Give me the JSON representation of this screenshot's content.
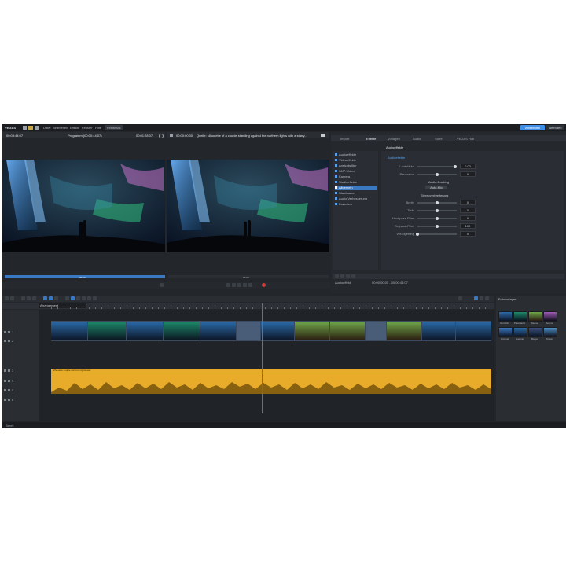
{
  "menubar": {
    "logo": "VEGAS",
    "items": [
      "Datei",
      "Bearbeiten",
      "Effekte",
      "Fenster",
      "Hilfe",
      "Feedback"
    ],
    "ok_label": "Anwenden",
    "cancel_label": "Beenden"
  },
  "source_monitor": {
    "timecode_left": "00:03:44:07",
    "title": "Programm (00:00:44:07)",
    "timecode_right": "00:01:28:07"
  },
  "program_monitor": {
    "timecode": "00:00:00:00",
    "title": "Quelle: silhouette of a couple standing against the northern lights with a starry..."
  },
  "monitor_scrub": {
    "left_progress": 1.0,
    "right_progress": 0.0,
    "left_label": "00:00",
    "right_label": "00:00"
  },
  "effects_panel": {
    "tabs": [
      "Import",
      "Effekte",
      "Vorlagen",
      "Audio",
      "Store",
      "VEGAS Hub"
    ],
    "active_tab": "Effekte",
    "header": "Audioeffekte",
    "categories": [
      "Audioeffekte",
      "Videoeffekte",
      "Ansichtsfilter",
      "360°-Video",
      "Kamera",
      "Studioeffekte",
      "Allgemein",
      "Stabilisator",
      "Audio Verbesserung",
      "Favoriten"
    ],
    "active_category_index": 6,
    "group_title": "Audioeffekte",
    "params": [
      {
        "label": "Lautstärke",
        "value": "0.00",
        "level": 0.95
      },
      {
        "label": "Panorama",
        "value": "0",
        "level": 0.5
      }
    ],
    "section_one": "Audio-Ducking",
    "section_one_button": "Auto-Mix",
    "section_two": "Stereoverbreiterung",
    "params2": [
      {
        "label": "Breite",
        "value": "0",
        "level": 0.5
      },
      {
        "label": "Tiefe",
        "value": "0",
        "level": 0.5
      },
      {
        "label": "Hochpass-Filter",
        "value": "0",
        "level": 0.5
      },
      {
        "label": "Tiefpass-Filter",
        "value": "100",
        "level": 0.5
      },
      {
        "label": "Verzögerung",
        "value": "0",
        "level": 0.0
      }
    ],
    "footer_field": "Audioeffekt",
    "footer_value": "00:00:00:00 - 00:00:44:07"
  },
  "timeline": {
    "title": "Arrangement",
    "tracks": [
      {
        "label": "1"
      },
      {
        "label": "2"
      },
      {
        "label": "3"
      },
      {
        "label": "4"
      },
      {
        "label": "5"
      },
      {
        "label": "6"
      }
    ],
    "audio_label": "silhouette couple northern lights.wav"
  },
  "templates_panel": {
    "title": "Fotovorlagen",
    "captions": [
      "Nordlicht",
      "Polarnacht",
      "Sterne",
      "Aurora",
      "Himmel",
      "Galaxie",
      "Berge",
      "Wolken"
    ]
  },
  "status": {
    "text": "Bereit"
  }
}
